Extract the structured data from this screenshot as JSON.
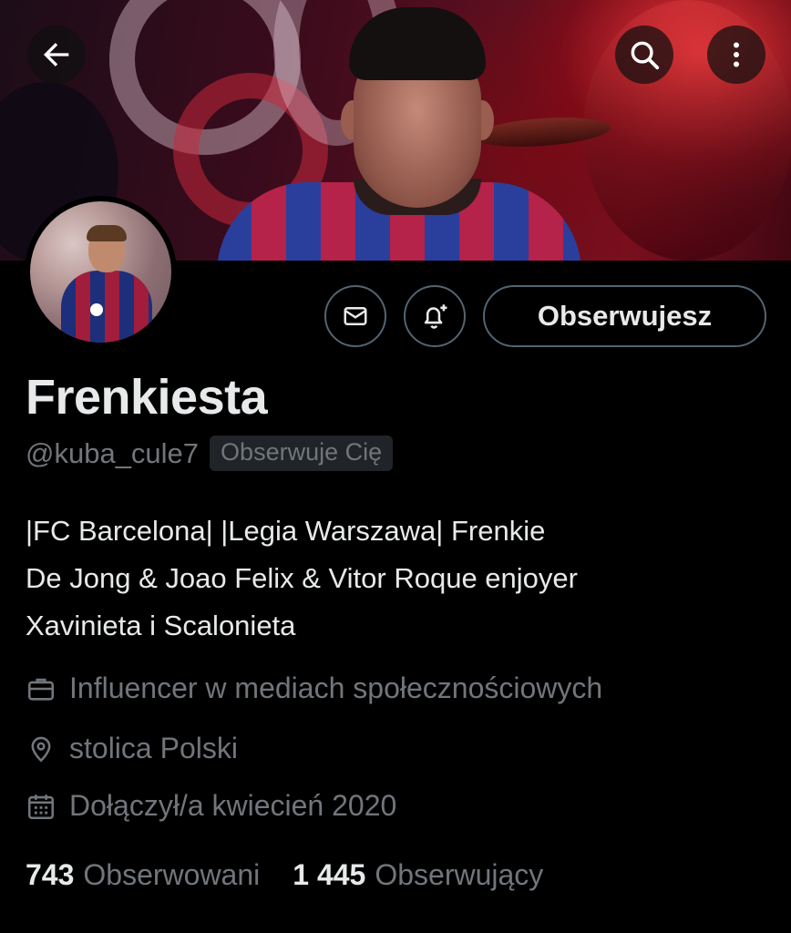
{
  "header": {
    "back_icon": "arrow-left-icon",
    "search_icon": "search-icon",
    "more_icon": "more-vertical-icon"
  },
  "actions": {
    "message_icon": "envelope-icon",
    "notify_icon": "bell-plus-icon",
    "follow_label": "Obserwujesz"
  },
  "profile": {
    "display_name": "Frenkiesta",
    "handle": "@kuba_cule7",
    "follows_you_badge": "Obserwuje Cię",
    "bio_lines": [
      "|FC Barcelona| |Legia Warszawa| Frenkie",
      "De Jong & Joao Felix & Vitor Roque enjoyer",
      "Xavinieta i Scalonieta"
    ],
    "category": "Influencer w mediach społecznościowych",
    "location": "stolica Polski",
    "joined": "Dołączył/a kwiecień 2020"
  },
  "stats": {
    "following_count": "743",
    "following_label": "Obserwowani",
    "followers_count": "1 445",
    "followers_label": "Obserwujący"
  },
  "colors": {
    "background": "#000000",
    "text_primary": "#e7e9ea",
    "text_secondary": "#71767b",
    "border": "#536471"
  }
}
